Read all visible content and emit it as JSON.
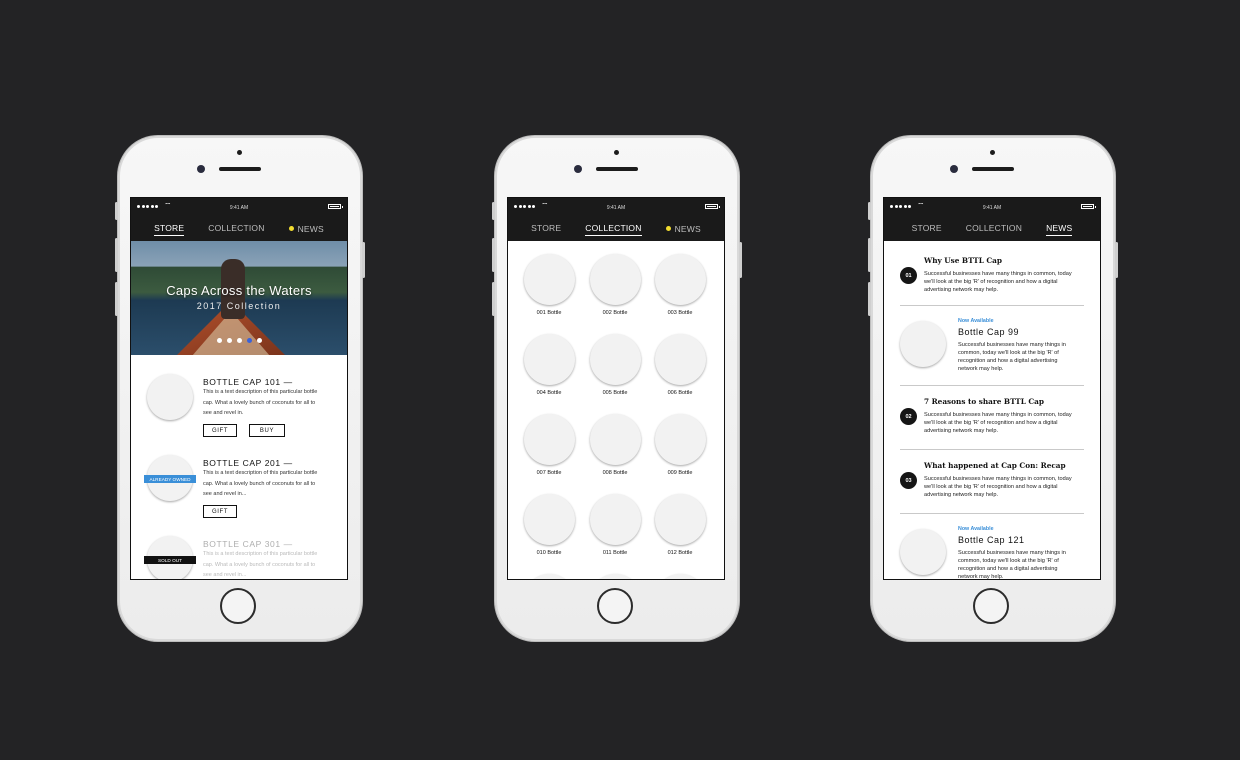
{
  "status": {
    "time": "9:41 AM"
  },
  "nav": {
    "store": "STORE",
    "collection": "COLLECTION",
    "news": "NEWS"
  },
  "colors": {
    "background": "#232325",
    "accent_blue": "#3a8fd8",
    "indicator_yellow": "#f2dc2f",
    "sold_out": "#111111"
  },
  "store": {
    "hero": {
      "title": "Caps Across the Waters",
      "subtitle": "2017 Collection",
      "slides": 5,
      "active_slide": 4
    },
    "items": [
      {
        "name": "BOTTLE CAP 101 —",
        "desc": "This is a text description of this particular bottle cap. What a lovely bunch of coconuts for all to see and revel in.",
        "badge": "",
        "buttons": [
          "GIFT",
          "BUY"
        ]
      },
      {
        "name": "BOTTLE CAP 201 —",
        "desc": "This is a text description of this particular bottle cap. What a lovely bunch of coconuts for all to see and revel in...",
        "badge": "ALREADY OWNED",
        "buttons": [
          "GIFT"
        ]
      },
      {
        "name": "BOTTLE CAP 301 —",
        "desc": "This is a text description of this particular bottle cap. What a lovely bunch of coconuts for all to see and revel in...",
        "badge": "SOLD OUT",
        "buttons": []
      }
    ]
  },
  "collection": {
    "items": [
      "001 Bottle",
      "002 Bottle",
      "003 Bottle",
      "004 Bottle",
      "005 Bottle",
      "006 Bottle",
      "007 Bottle",
      "008 Bottle",
      "009 Bottle",
      "010 Bottle",
      "011 Bottle",
      "012 Bottle"
    ]
  },
  "news": {
    "articles": [
      {
        "num": "01",
        "headline": "Why Use BTTL Cap",
        "body": "Successful businesses have many things in common, today we'll look at the big 'R' of recognition and how a digital advertising network may help."
      },
      {
        "num": "02",
        "headline": "7 Reasons to share BTTL Cap",
        "body": "Successful businesses have many things in common, today we'll look at the big 'R' of recognition and how a digital advertising network may help."
      },
      {
        "num": "03",
        "headline": "What happened at Cap Con: Recap",
        "body": "Successful businesses have many things in common, today we'll look at the big 'R' of recognition and how a digital advertising network may help."
      }
    ],
    "promos": [
      {
        "availability": "Now Available",
        "name": "Bottle Cap 99",
        "desc": "Successful businesses have many things in common, today we'll look at the big 'R' of recognition and how a digital advertising network may help."
      },
      {
        "availability": "Now Available",
        "name": "Bottle Cap 121",
        "desc": "Successful businesses have many things in common, today we'll look at the big 'R' of recognition and how a digital advertising network may help."
      }
    ]
  }
}
